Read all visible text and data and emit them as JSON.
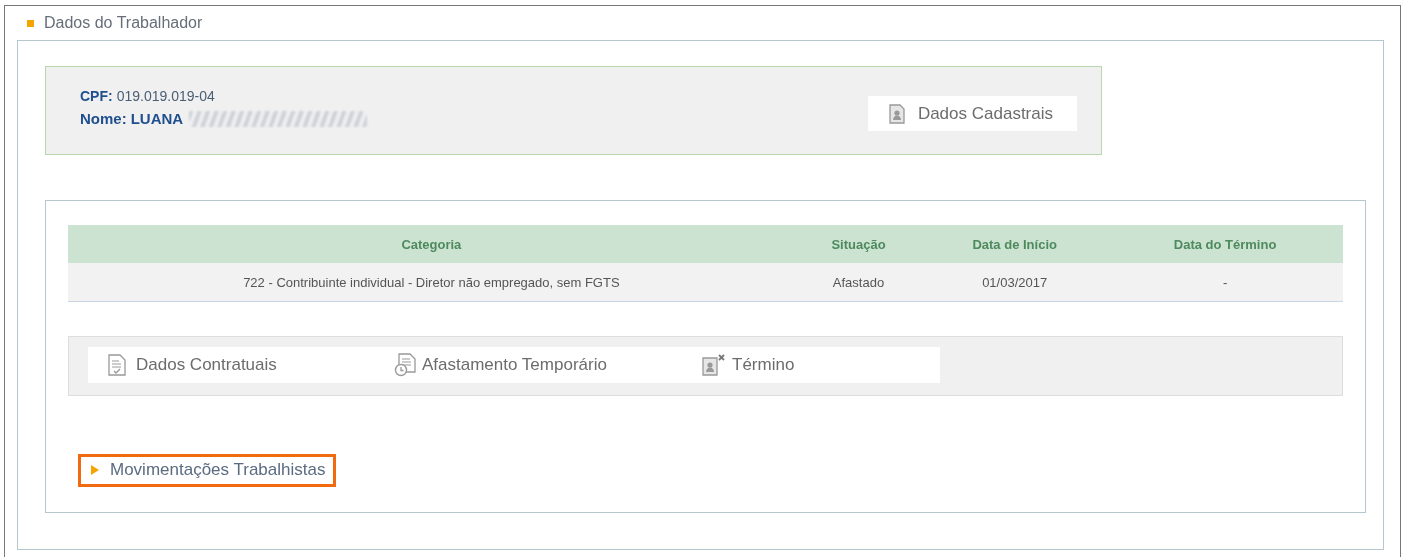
{
  "section": {
    "title": "Dados do Trabalhador"
  },
  "worker": {
    "cpf_label": "CPF:",
    "cpf": "019.019.019-04",
    "name_label": "Nome:",
    "name": "LUANA",
    "name_redacted": true
  },
  "profile_button": {
    "label": "Dados Cadastrais"
  },
  "table": {
    "columns": [
      "Categoria",
      "Situação",
      "Data de Início",
      "Data do Término"
    ],
    "rows": [
      [
        "722 - Contribuinte individual - Diretor não empregado, sem FGTS",
        "Afastado",
        "01/03/2017",
        "-"
      ]
    ]
  },
  "actions": [
    {
      "kind": "contract",
      "label": "Dados Contratuais"
    },
    {
      "kind": "leave",
      "label": "Afastamento Temporário"
    },
    {
      "kind": "end",
      "label": "Término"
    }
  ],
  "movements": {
    "label": "Movimentações Trabalhistas",
    "expanded": false,
    "highlighted": true
  }
}
